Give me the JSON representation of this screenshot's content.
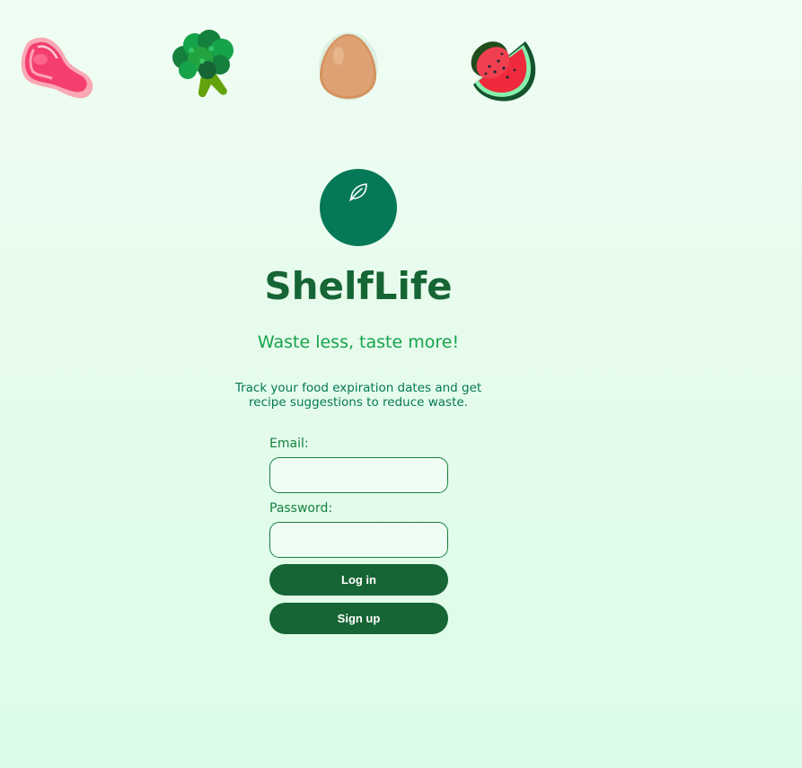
{
  "app": {
    "title": "ShelfLife",
    "tagline": "Waste less, taste more!",
    "description": "Track your food expiration dates and get recipe suggestions to reduce waste."
  },
  "icons": {
    "logo": "leaf-icon",
    "foods": [
      "meat-icon",
      "broccoli-icon",
      "egg-icon",
      "watermelon-icon"
    ]
  },
  "form": {
    "email_label": "Email:",
    "email_value": "",
    "password_label": "Password:",
    "password_value": "",
    "login_label": "Log in",
    "signup_label": "Sign up"
  },
  "colors": {
    "brand": "#047857",
    "title": "#166534",
    "tagline": "#16a34a",
    "button": "#166534",
    "background": "#f0fdf4"
  }
}
